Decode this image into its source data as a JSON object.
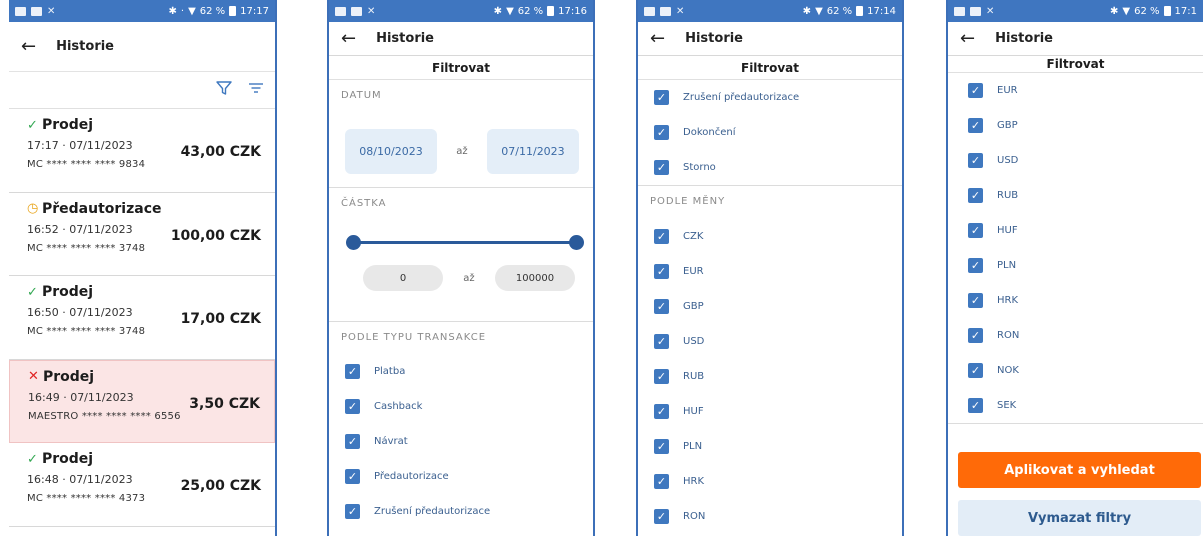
{
  "statusbars": [
    {
      "bluetooth": "✱",
      "extra": "·",
      "battery": "62 %",
      "time": "17:17"
    },
    {
      "bluetooth": "✱",
      "extra": "",
      "battery": "62 %",
      "time": "17:16"
    },
    {
      "bluetooth": "✱",
      "extra": "",
      "battery": "62 %",
      "time": "17:14"
    },
    {
      "bluetooth": "✱",
      "extra": "",
      "battery": "62 %",
      "time": "17:1"
    }
  ],
  "header": {
    "back": "←",
    "title": "Historie"
  },
  "list": {
    "transactions": [
      {
        "status": "ok",
        "icon": "✓",
        "name": "Prodej",
        "time": "17:17 · 07/11/2023",
        "amount": "43,00 CZK",
        "card": "MC **** **** **** 9834"
      },
      {
        "status": "warn",
        "icon": "◷",
        "name": "Předautorizace",
        "time": "16:52 · 07/11/2023",
        "amount": "100,00 CZK",
        "card": "MC **** **** **** 3748"
      },
      {
        "status": "ok",
        "icon": "✓",
        "name": "Prodej",
        "time": "16:50 · 07/11/2023",
        "amount": "17,00 CZK",
        "card": "MC **** **** **** 3748"
      },
      {
        "status": "bad",
        "icon": "✕",
        "name": "Prodej",
        "time": "16:49 · 07/11/2023",
        "amount": "3,50 CZK",
        "card": "MAESTRO **** **** **** 6556"
      },
      {
        "status": "ok",
        "icon": "✓",
        "name": "Prodej",
        "time": "16:48 · 07/11/2023",
        "amount": "25,00 CZK",
        "card": "MC **** **** **** 4373"
      }
    ]
  },
  "filter": {
    "heading": "Filtrovat",
    "date_section": "DATUM",
    "date_from": "08/10/2023",
    "date_to": "07/11/2023",
    "range_sep": "až",
    "amount_section": "ČÁSTKA",
    "amount_min": "0",
    "amount_max": "100000",
    "type_section": "PODLE TYPU TRANSAKCE",
    "types_p2": [
      "Platba",
      "Cashback",
      "Návrat",
      "Předautorizace",
      "Zrušení předautorizace"
    ],
    "types_p3": [
      "Zrušení předautorizace",
      "Dokončení",
      "Storno"
    ],
    "currency_section": "PODLE MĚNY",
    "currencies_p3": [
      "CZK",
      "EUR",
      "GBP",
      "USD",
      "RUB",
      "HUF",
      "PLN",
      "HRK",
      "RON"
    ],
    "currencies_p4": [
      "EUR",
      "GBP",
      "USD",
      "RUB",
      "HUF",
      "PLN",
      "HRK",
      "RON",
      "NOK",
      "SEK"
    ],
    "checkmark": "✓"
  },
  "actions": {
    "apply": "Aplikovat a vyhledat",
    "clear": "Vymazat filtry"
  },
  "colors": {
    "accent": "#3f78bf",
    "primary_button": "#ff6a08",
    "status_bar": "#3f76c0"
  }
}
